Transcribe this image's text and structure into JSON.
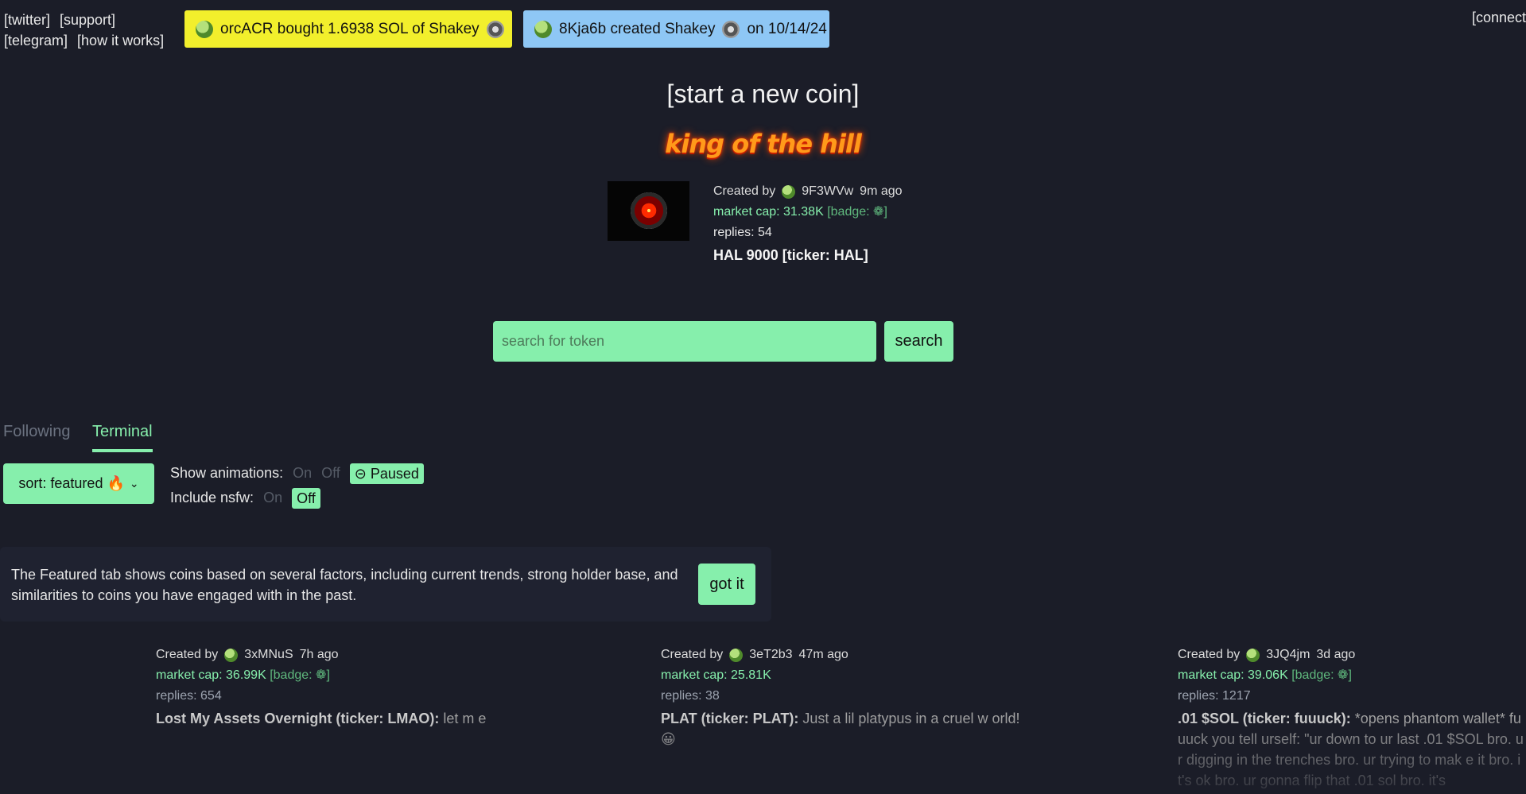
{
  "nav": {
    "twitter": "[twitter]",
    "support": "[support]",
    "telegram": "[telegram]",
    "how": "[how it works]",
    "connect": "[connect"
  },
  "ticker": {
    "buy": "orcACR  bought 1.6938 SOL of Shakey",
    "create_user": "8Kja6b created Shakey",
    "create_date": "on 10/14/24"
  },
  "start_coin": "[start a new coin]",
  "koth_title": "king of the hill",
  "king": {
    "created_by": "Created by",
    "user": "9F3WVw",
    "age": "9m ago",
    "market_cap": "market cap: 31.38K",
    "badge": "[badge: ❁]",
    "replies": "replies: 54",
    "name": "HAL 9000 [ticker: HAL]"
  },
  "search": {
    "placeholder": "search for token",
    "button": "search"
  },
  "tabs": {
    "following": "Following",
    "terminal": "Terminal"
  },
  "sort": {
    "label": "sort: featured 🔥"
  },
  "toggles": {
    "animations_label": "Show animations:",
    "on": "On",
    "off": "Off",
    "paused": "⊝ Paused",
    "nsfw_label": "Include nsfw:",
    "nsfw_on": "On",
    "nsfw_off": "Off"
  },
  "notice": {
    "text": "The Featured tab shows coins based on several factors, including current trends, strong holder base, and similarities to coins you have engaged with in the past.",
    "button": "got it"
  },
  "cards": [
    {
      "created_by": "Created by",
      "user": "3xMNuS",
      "age": "7h ago",
      "market_cap": "market cap: 36.99K",
      "badge": "[badge: ❁]",
      "replies": "replies: 654",
      "title": "Lost My Assets Overnight (ticker: LMAO):",
      "desc": " let m e"
    },
    {
      "created_by": "Created by",
      "user": "3eT2b3",
      "age": "47m ago",
      "market_cap": "market cap: 25.81K",
      "badge": "",
      "replies": "replies: 38",
      "title": "PLAT (ticker: PLAT):",
      "desc": " Just a lil platypus in a cruel w orld!😀"
    },
    {
      "created_by": "Created by",
      "user": "3JQ4jm",
      "age": "3d ago",
      "market_cap": "market cap: 39.06K",
      "badge": "[badge: ❁]",
      "replies": "replies: 1217",
      "title": ".01 $SOL (ticker: fuuuck):",
      "desc": " *opens phantom wallet* fuuuck you tell urself: \"ur down to ur last .01 $SOL bro. ur digging in the trenches bro. ur trying to mak e it bro. it's ok bro. ur gonna flip that .01 sol bro. it's"
    }
  ]
}
